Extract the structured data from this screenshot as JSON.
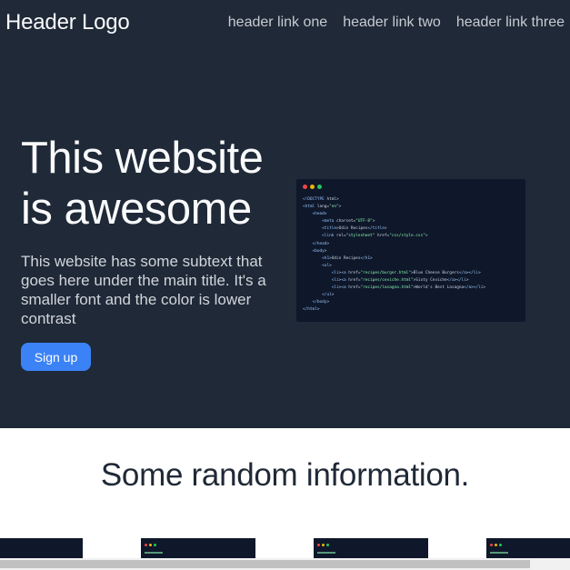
{
  "header": {
    "logo": "Header Logo",
    "links": [
      "header link one",
      "header link two",
      "header link three"
    ]
  },
  "hero": {
    "title": "This website is awesome",
    "subtext": "This website has some subtext that goes here under the main title. It's a smaller font and the color is lower contrast",
    "signup_label": "Sign up",
    "code_lines": [
      "<!DOCTYPE html>",
      "<html lang=\"en\">",
      "    <head>",
      "        <meta charset=\"UTF-8\">",
      "        <title>Odin Recipes</title>",
      "        <link rel=\"stylesheet\" href=\"css/style.css\">",
      "    </head>",
      "    <body>",
      "        <h1>Odin Recipes</h1>",
      "        <ul>",
      "            <li><a href=\"recipes/burger.html\">Blue Cheese Burgers</a></li>",
      "            <li><a href=\"recipes/ceviche.html\">Sixty Ceviche</a></li>",
      "            <li><a href=\"recipes/lasagna.html\">World's Best Lasagna</a></li>",
      "        </ul>",
      "    </body>",
      "</html>"
    ]
  },
  "info": {
    "title": "Some random information."
  },
  "colors": {
    "hero_bg": "#1f2937",
    "accent": "#3b82f6",
    "code_bg": "#0f172a"
  }
}
